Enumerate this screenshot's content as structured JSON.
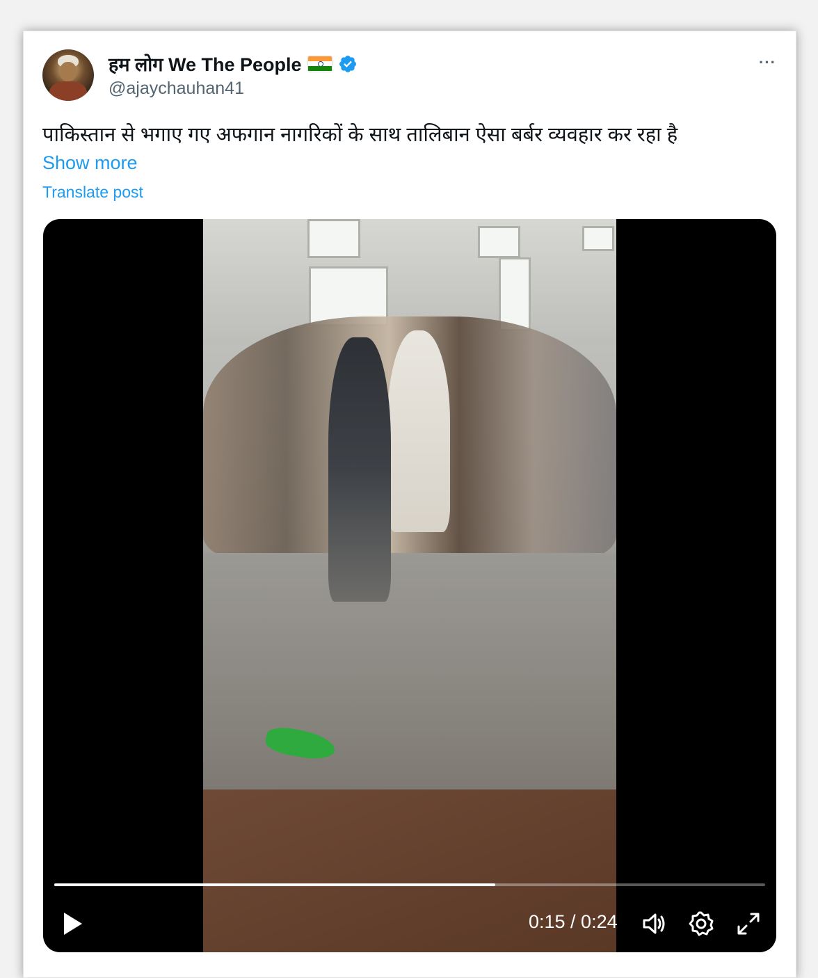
{
  "post": {
    "display_name": "हम लोग We The People",
    "handle": "@ajaychauhan41",
    "text": "पाकिस्तान से भगाए गए अफगान नागरिकों के साथ तालिबान ऐसा बर्बर व्यवहार कर रहा है",
    "show_more_label": "Show more",
    "translate_label": "Translate post",
    "more_icon": "···"
  },
  "video": {
    "time_display": "0:15 / 0:24",
    "progress_fraction": 0.62,
    "icons": [
      "play-icon",
      "volume-icon",
      "settings-icon",
      "fullscreen-icon"
    ]
  },
  "colors": {
    "link": "#1d9bf0",
    "text": "#0f1419",
    "muted": "#536471",
    "verified": "#1d9bf0",
    "flag_saffron": "#ff9933",
    "flag_green": "#138808"
  }
}
